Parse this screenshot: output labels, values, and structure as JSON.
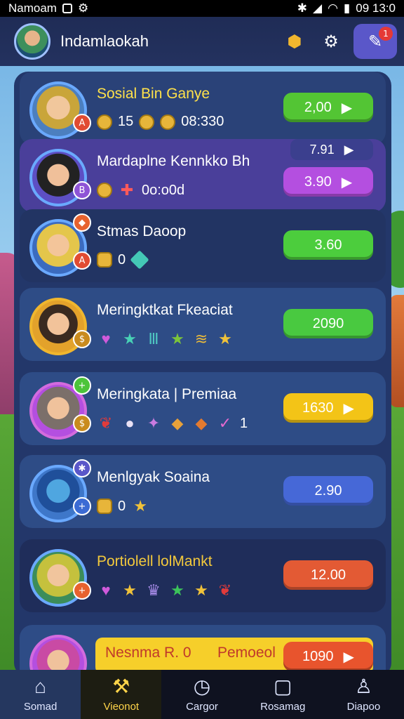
{
  "status_bar": {
    "carrier": "Namoam",
    "time": "09 13:0"
  },
  "header": {
    "title": "Indamlaokah",
    "notification_count": "1"
  },
  "rows": [
    {
      "name": "Sosial Bin Ganye",
      "stat": "15",
      "time": "08:330",
      "button": "2,00",
      "button_color": "#53c534"
    },
    {
      "name": "Mardaplne Kennkko Bh",
      "timer": "0o:o0d",
      "top_pill": "7.91",
      "button": "3.90",
      "button_color": "#b44fe0"
    },
    {
      "name": "Stmas Daoop",
      "stat": "0",
      "button": "3.60",
      "button_color": "#4ccd3d"
    },
    {
      "name": "Meringktkat Fkeaciat",
      "button": "2090",
      "button_color": "#49c940"
    },
    {
      "name": "Meringkata | Premiaa",
      "stat": "1",
      "button": "1630",
      "button_color": "#f3c417"
    },
    {
      "name": "Menlgyak Soaina",
      "stat": "0",
      "button": "2.90",
      "button_color": "#4668d7"
    },
    {
      "name": "Portiolell lolMankt",
      "button": "12.00",
      "button_color": "#e35a34"
    },
    {
      "name": "Nesnma R. 0",
      "name2": "Pemoeol",
      "button": "1090",
      "button_color": "#e8542d"
    }
  ],
  "nav": [
    {
      "label": "Somad",
      "icon": "home-icon"
    },
    {
      "label": "Vieonot",
      "icon": "hammer-icon"
    },
    {
      "label": "Cargor",
      "icon": "clock-icon"
    },
    {
      "label": "Rosamag",
      "icon": "box-icon"
    },
    {
      "label": "Diapoo",
      "icon": "person-icon"
    }
  ]
}
